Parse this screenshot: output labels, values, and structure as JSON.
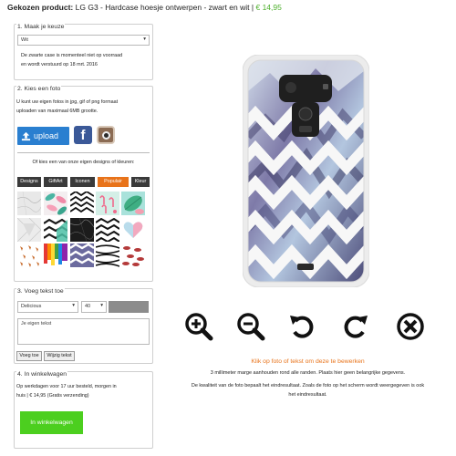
{
  "header": {
    "label": "Gekozen product:",
    "product": "LG G3 - Hardcase hoesje ontwerpen - zwart en wit",
    "separator": "|",
    "price": "€ 14,95"
  },
  "step1": {
    "title": "1. Maak je keuze",
    "select_value": "Wit",
    "notice_line1": "De zwarte case is momenteel niet op voorraad",
    "notice_line2": "en wordt verstuurd op 18 mrt. 2016"
  },
  "step2": {
    "title": "2. Kies een foto",
    "info_line1": "U kunt uw eigen fotos in jpg, gif of png formaat",
    "info_line2": "uploaden van maximaal 6MB grootte.",
    "upload_label": "upload",
    "facebook_glyph": "f",
    "designs_prompt": "Of kies een van onze eigen designs of kleuren:",
    "tabs": [
      "Designs",
      "GiftArt",
      "Iconen",
      "Populair",
      "Kleur"
    ],
    "active_tab": "Populair"
  },
  "step3": {
    "title": "3. Voeg tekst toe",
    "font_value": "Delicious",
    "size_value": "40",
    "text_placeholder": "Je eigen tekst",
    "add_button": "Voeg toe",
    "edit_button": "Wijzig tekst"
  },
  "step4": {
    "title": "4. In winkelwagen",
    "info_line1": "Op werkdagen voor 17 uur besteld, morgen in",
    "info_line2": "huis | € 14,95 (Gratis verzending)",
    "cart_button": "In winkelwagen"
  },
  "editor": {
    "hint": "Klik op foto of tekst om deze te bewerken",
    "margin_note": "3 millimeter marge aanhouden rond alle randen. Plaats hier geen belangrijke gegevens.",
    "quality_line1": "De kwaliteit van de foto bepaalt het eindresultaat. Zoals de foto op het scherm wordt weergegeven is ook",
    "quality_line2": "het eindresultaat.",
    "tools": [
      "zoom-in-icon",
      "zoom-out-icon",
      "rotate-left-icon",
      "rotate-right-icon",
      "delete-icon"
    ]
  },
  "colors": {
    "accent_orange": "#e8731a",
    "price_green": "#4caf2b",
    "cart_green": "#4ccf1f",
    "upload_blue": "#2a7fd0",
    "facebook_blue": "#3b5998",
    "tab_dark": "#3a3a3a"
  }
}
